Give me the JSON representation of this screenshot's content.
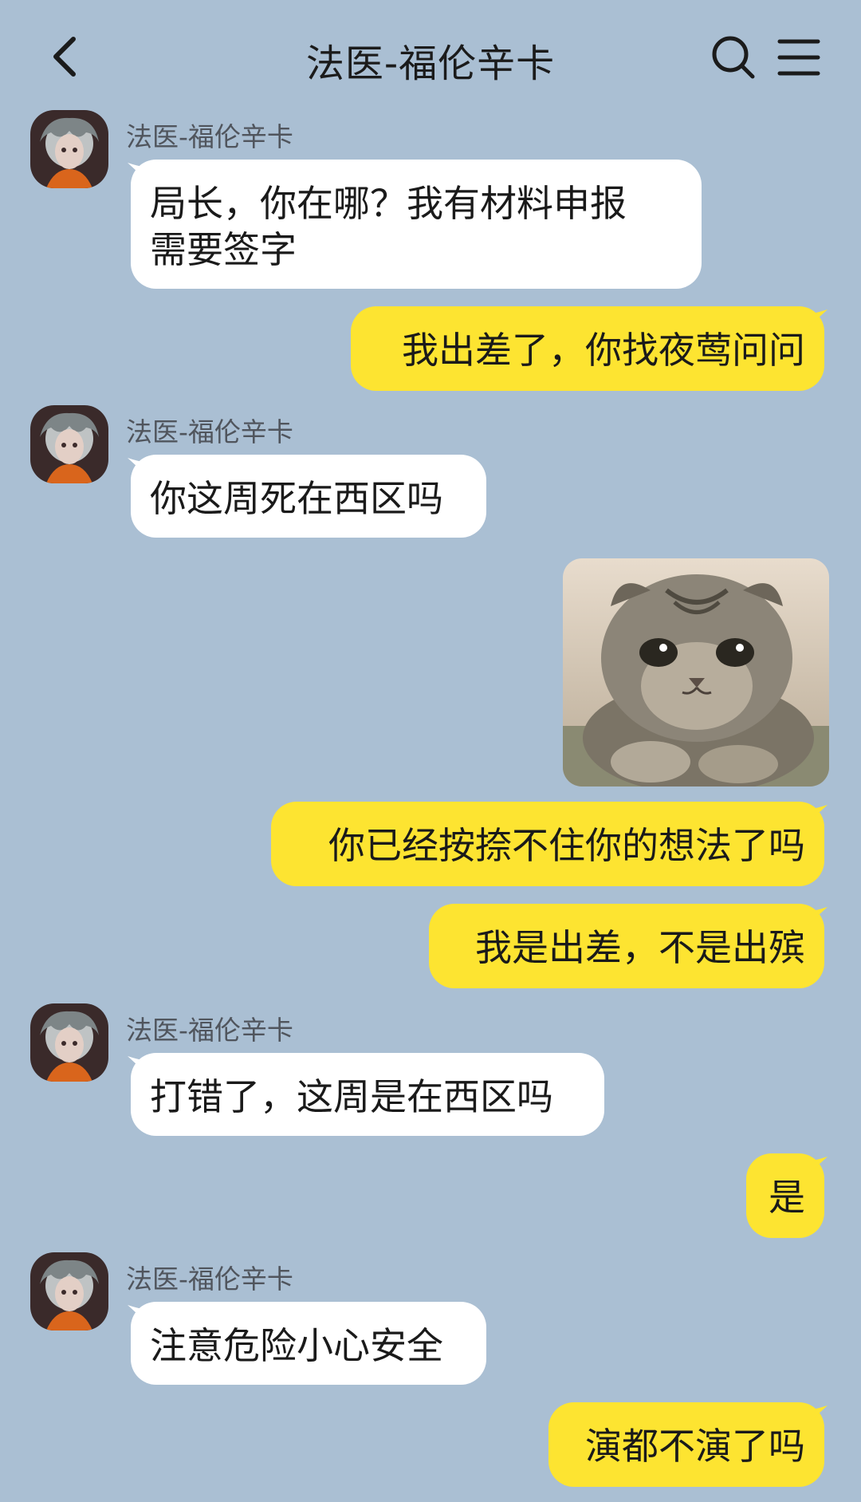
{
  "header": {
    "back_icon": "chevron-left-icon",
    "title": "法医-福伦辛卡",
    "search_icon": "search-icon",
    "menu_icon": "menu-icon"
  },
  "colors": {
    "background": "#aabfd3",
    "incoming_bubble": "#ffffff",
    "outgoing_bubble": "#fde431"
  },
  "messages": [
    {
      "direction": "in",
      "sender": "法医-福伦辛卡",
      "lines": [
        "局长，你在哪？我有材料申报",
        "需要签字"
      ]
    },
    {
      "direction": "out",
      "text": "我出差了，你找夜莺问问"
    },
    {
      "direction": "in",
      "sender": "法医-福伦辛卡",
      "text": "你这周死在西区吗"
    },
    {
      "direction": "out",
      "type": "image",
      "image": "cat-sticker"
    },
    {
      "direction": "out",
      "text": "你已经按捺不住你的想法了吗"
    },
    {
      "direction": "out",
      "text": "我是出差，不是出殡"
    },
    {
      "direction": "in",
      "sender": "法医-福伦辛卡",
      "text": "打错了，这周是在西区吗"
    },
    {
      "direction": "out",
      "text": "是"
    },
    {
      "direction": "in",
      "sender": "法医-福伦辛卡",
      "text": "注意危险小心安全"
    },
    {
      "direction": "out",
      "text": "演都不演了吗"
    }
  ]
}
